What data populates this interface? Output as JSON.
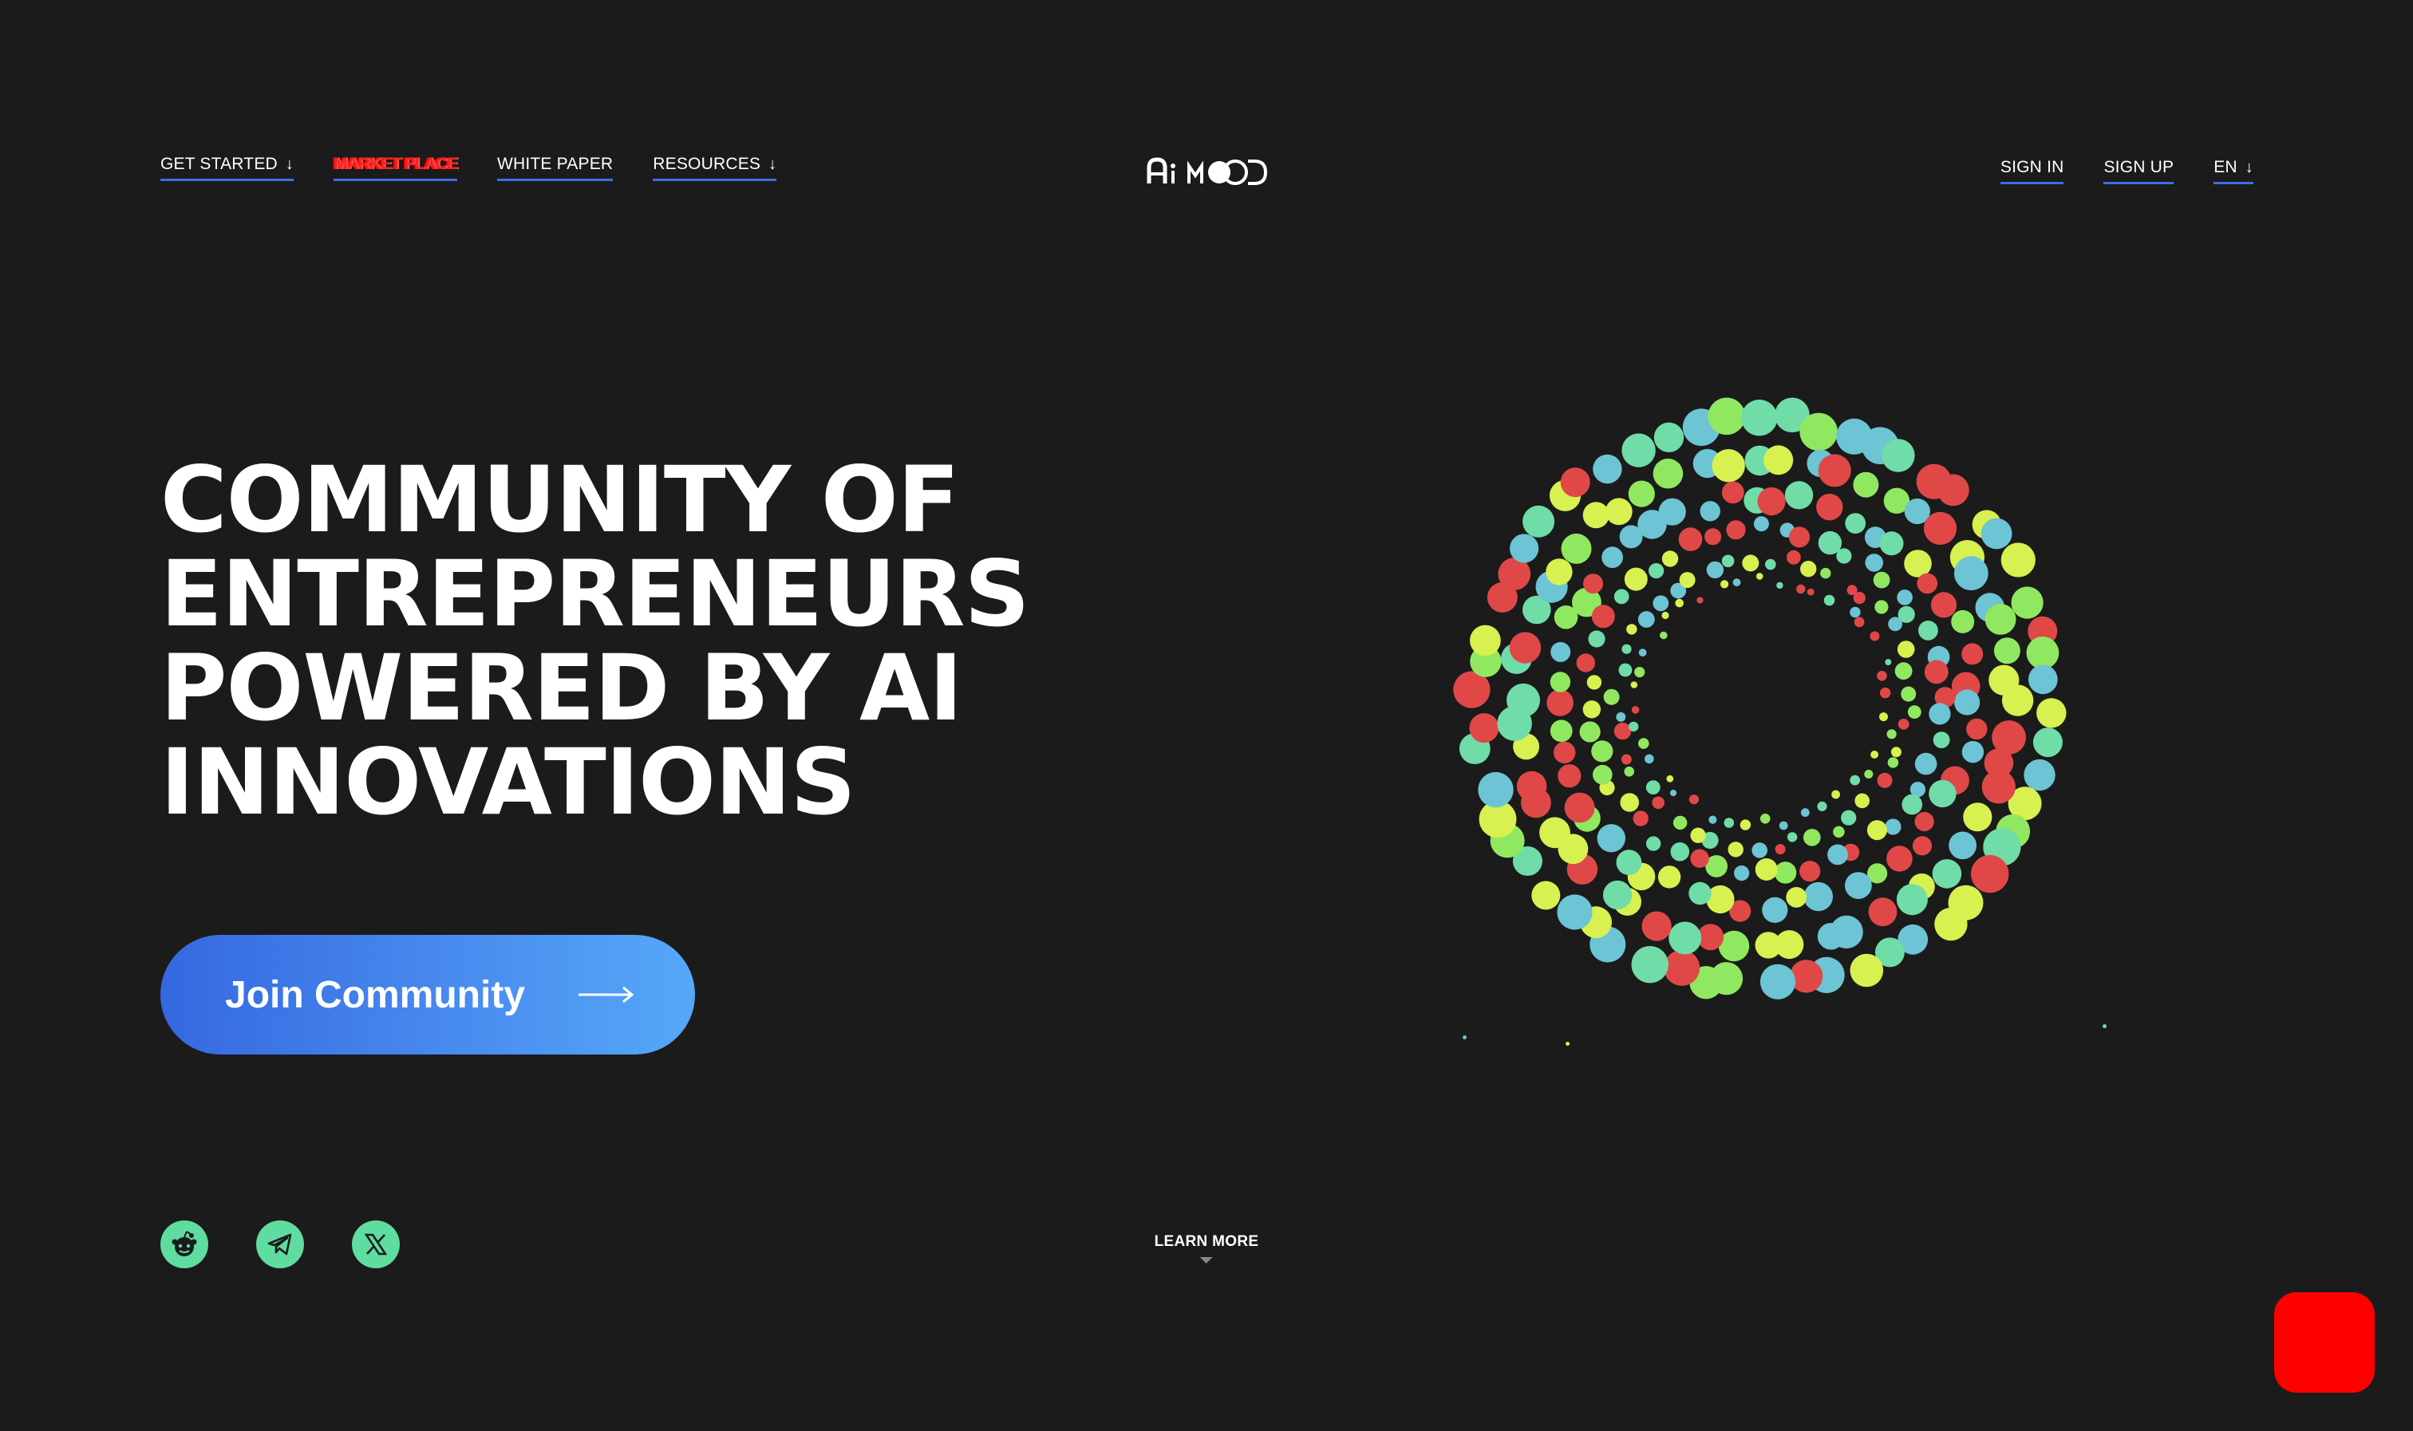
{
  "colors": {
    "background": "#1b1b1b",
    "accent_blue": "#3a6fe8",
    "social_green": "#5fdca0",
    "glitch_red": "#ff2020",
    "widget_red": "#ff0000",
    "dot_red": "#e04848",
    "dot_yellow": "#d8f050",
    "dot_green": "#90e860",
    "dot_blue": "#6cc4d4",
    "dot_mint": "#70dca8"
  },
  "header": {
    "logo_alt": "Ai MOOD",
    "nav_left": [
      {
        "label": "GET STARTED",
        "icon": "arrow-down-icon"
      },
      {
        "label": "MARKET PLACE"
      },
      {
        "label": "WHITE PAPER"
      },
      {
        "label": "RESOURCES",
        "icon": "arrow-down-icon"
      }
    ],
    "nav_right": [
      {
        "label": "SIGN IN"
      },
      {
        "label": "SIGN UP"
      },
      {
        "label": "EN",
        "icon": "arrow-down-icon"
      }
    ]
  },
  "hero": {
    "title_lines": [
      "COMMUNITY OF",
      "ENTREPRENEURS",
      "POWERED BY AI",
      "INNOVATIONS"
    ],
    "cta_label": "Join Community",
    "cta_icon": "arrow-right-icon"
  },
  "socials": [
    {
      "name": "reddit",
      "icon": "reddit-icon"
    },
    {
      "name": "telegram",
      "icon": "telegram-icon"
    },
    {
      "name": "x",
      "icon": "x-icon"
    }
  ],
  "learn_more": {
    "label": "LEARN MORE",
    "icon": "caret-down-icon"
  },
  "widget": {
    "icon": "chat-widget-icon"
  }
}
